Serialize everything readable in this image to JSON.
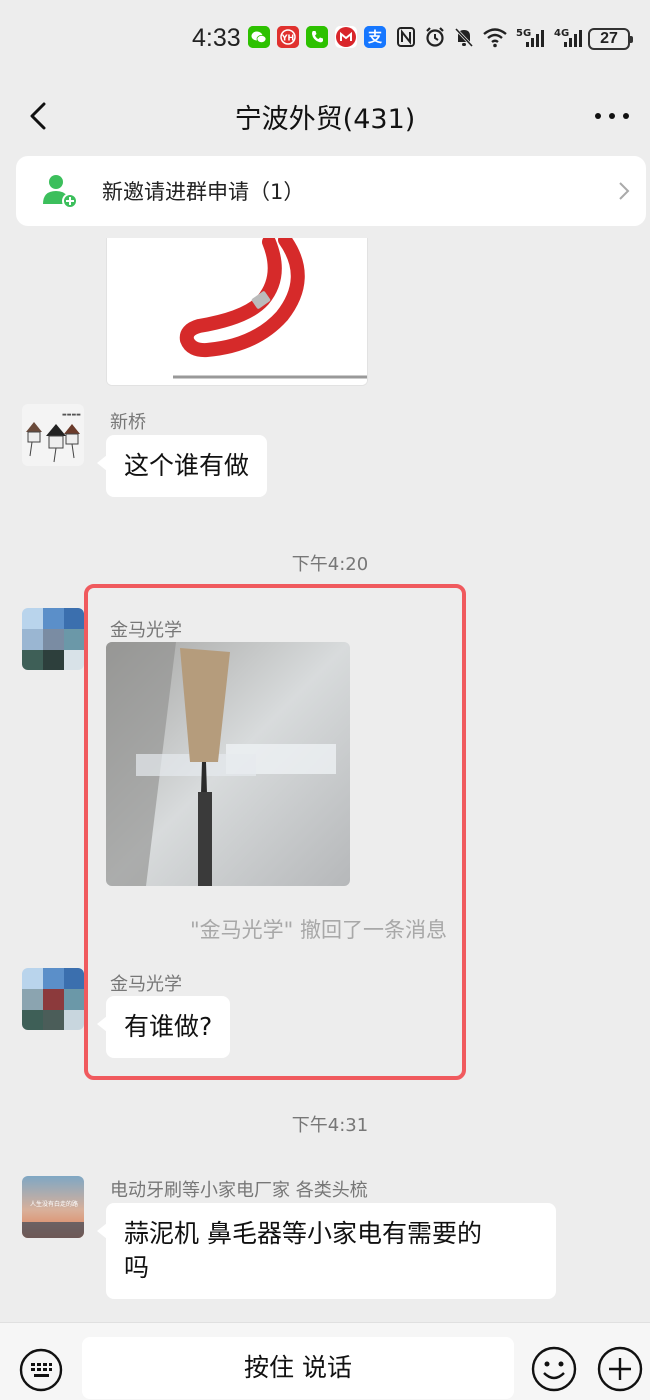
{
  "status_bar": {
    "time": "4:33",
    "apps": [
      {
        "name": "wechat-icon",
        "glyph": "",
        "color": "#2dc100"
      },
      {
        "name": "yh-app-icon",
        "glyph": "YH",
        "color": "#e0312e"
      },
      {
        "name": "phone-app-icon",
        "glyph": "",
        "color": "#2dc100"
      },
      {
        "name": "cmb-bank-icon",
        "glyph": "M",
        "color": "#d9262b"
      },
      {
        "name": "alipay-icon",
        "glyph": "支",
        "color": "#1677ff"
      }
    ],
    "network_5g": "5G",
    "network_4g": "4G",
    "battery": "27"
  },
  "header": {
    "title": "宁波外贸(431)"
  },
  "invite": {
    "text": "新邀请进群申请（1）"
  },
  "messages": {
    "m1_sender": "新桥",
    "m1_text": "这个谁有做",
    "time1": "下午4:20",
    "m2_sender": "金马光学",
    "recall_text": "\"金马光学\" 撤回了一条消息",
    "m3_sender": "金马光学",
    "m3_text": "有谁做?",
    "time2": "下午4:31",
    "m4_sender": "电动牙刷等小家电厂家  各类头梳",
    "m4_text_line1": "蒜泥机  鼻毛器等小家电有需要的",
    "m4_text_line2": "吗",
    "m4_avatar_text": "人生没有白走的路"
  },
  "input_bar": {
    "hold_to_talk": "按住 说话"
  },
  "colors": {
    "highlight": "#f05a5e",
    "background": "#ededed"
  }
}
